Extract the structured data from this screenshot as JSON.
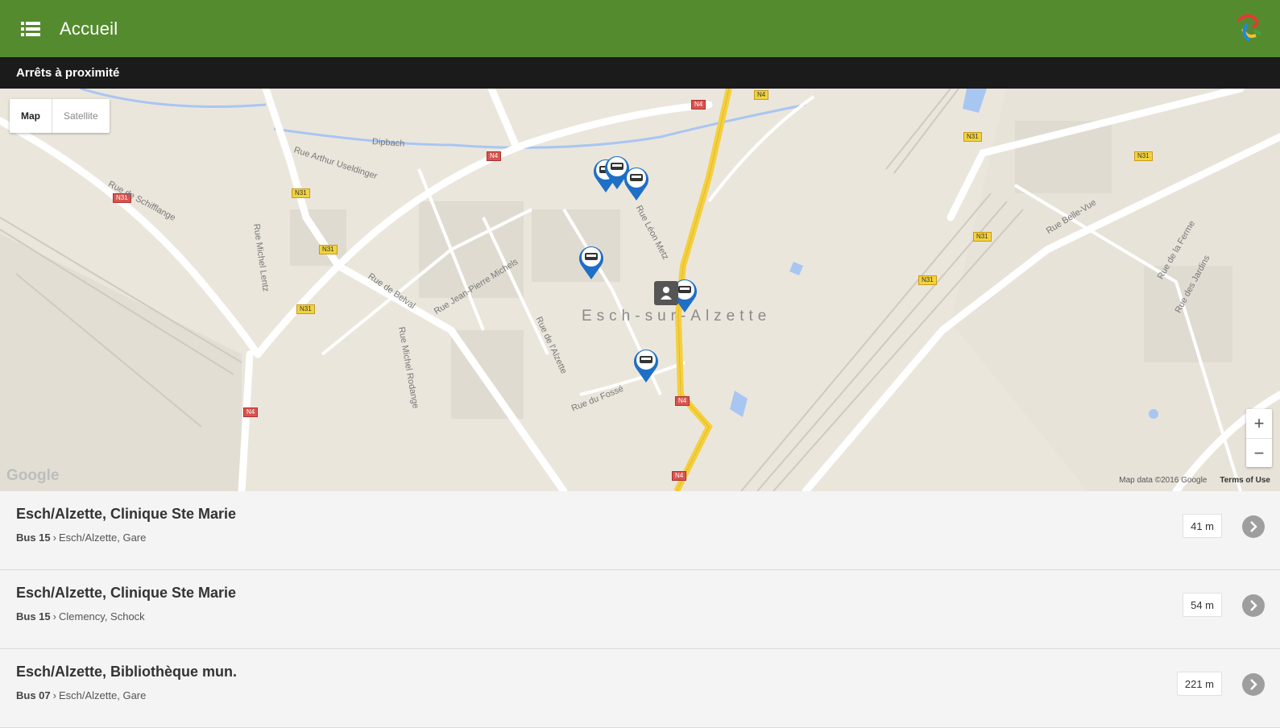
{
  "appbar": {
    "title": "Accueil",
    "menu_icon": "menu-icon",
    "logo_icon": "app-logo-icon",
    "color": "#558b2f"
  },
  "section": {
    "title": "Arrêts à proximité"
  },
  "map": {
    "maptype": {
      "map": "Map",
      "satellite": "Satellite"
    },
    "city": "Esch-sur-Alzette",
    "zoom_in": "+",
    "zoom_out": "−",
    "data_attribution": "Map data ©2016 Google",
    "terms": "Terms of Use",
    "google": "Google",
    "streets": [
      "Rue de Schifflange",
      "Rue Arthur Useldinger",
      "Rue Michel Lentz",
      "Rue de Belval",
      "Rue Jean-Pierre Michels",
      "Rue de l'Alzette",
      "Rue du Fossé",
      "Rue Léon Metz",
      "Rue Belle-Vue",
      "Rue de la Ferme",
      "Rue des Jardins",
      "Rue Michel Rodange",
      "Dipbach"
    ]
  },
  "stops": [
    {
      "name": "Esch/Alzette, Clinique Ste Marie",
      "line": "Bus 15",
      "destination": "Esch/Alzette, Gare",
      "distance": "41 m"
    },
    {
      "name": "Esch/Alzette, Clinique Ste Marie",
      "line": "Bus 15",
      "destination": "Clemency, Schock",
      "distance": "54 m"
    },
    {
      "name": "Esch/Alzette, Bibliothèque mun.",
      "line": "Bus 07",
      "destination": "Esch/Alzette, Gare",
      "distance": "221 m"
    }
  ]
}
